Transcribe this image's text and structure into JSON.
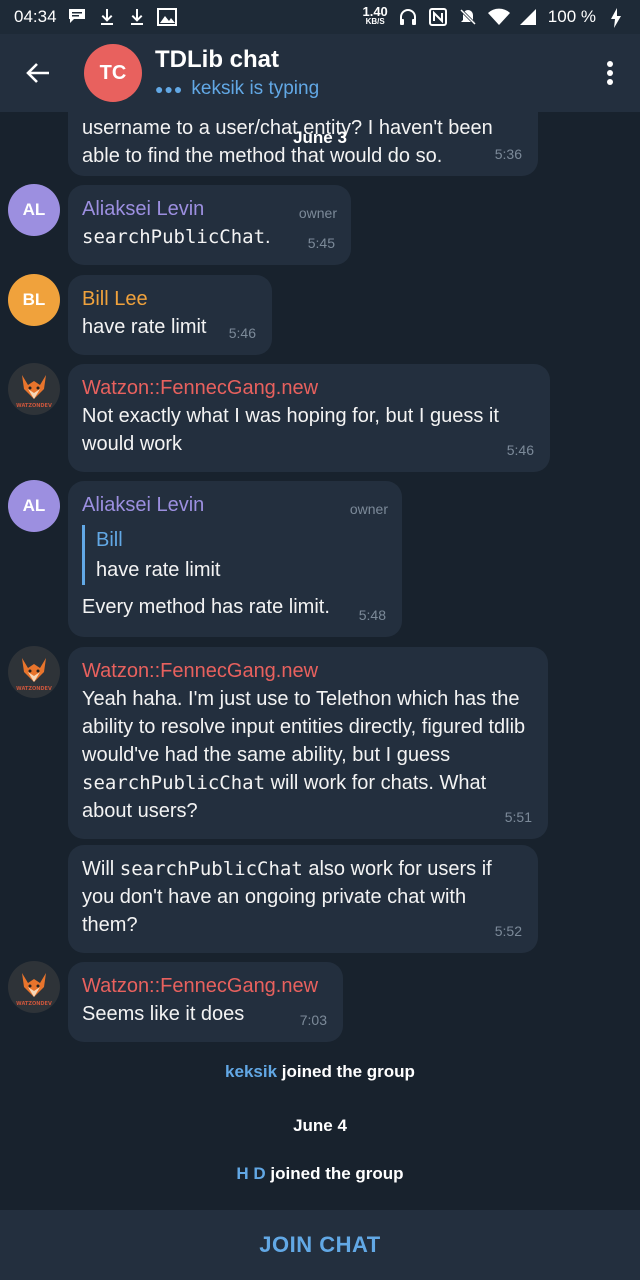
{
  "status_bar": {
    "time": "04:34",
    "net_speed_value": "1.40",
    "net_speed_unit": "KB/S",
    "battery": "100 %",
    "icons": [
      "chat-notification-icon",
      "download-icon",
      "download-icon",
      "gallery-icon",
      "headphones-icon",
      "nfc-icon",
      "mute-bell-icon",
      "wifi-icon",
      "signal-icon",
      "charging-icon"
    ]
  },
  "header": {
    "avatar_initials": "TC",
    "avatar_color": "#e8615e",
    "title": "TDLib chat",
    "status": "keksik is typing"
  },
  "floating_date": "June 3",
  "messages": [
    {
      "text": "username to a user/chat entity? I haven't been able to find the method that would do so.",
      "time": "5:36"
    },
    {
      "author": "Aliaksei Levin",
      "author_color": "#9c8fe0",
      "avatar": "AL",
      "avatar_color": "#9c8fe0",
      "badge": "owner",
      "code": "searchPublicChat",
      "text_after": ".",
      "time": "5:45"
    },
    {
      "author": "Bill Lee",
      "author_color": "#f0a23c",
      "avatar": "BL",
      "avatar_color": "#f0a23c",
      "text": "have rate limit",
      "time": "5:46"
    },
    {
      "author": "Watzon::FennecGang.new",
      "author_color": "#e8615e",
      "text": "Not exactly what I was hoping for, but I guess it would work",
      "time": "5:46"
    },
    {
      "author": "Aliaksei Levin",
      "author_color": "#9c8fe0",
      "avatar": "AL",
      "avatar_color": "#9c8fe0",
      "badge": "owner",
      "reply_name": "Bill",
      "reply_text": "have rate limit",
      "text": "Every method has rate limit.",
      "time": "5:48"
    },
    {
      "author": "Watzon::FennecGang.new",
      "author_color": "#e8615e",
      "text_before": "Yeah haha. I'm just use to Telethon which has the ability to resolve input entities directly, figured tdlib would've had the same ability, but I guess ",
      "code": "searchPublicChat",
      "text_after": " will work for chats. What about users?",
      "time": "5:51"
    },
    {
      "text_before": "Will ",
      "code": "searchPublicChat",
      "text_after": " also work for users if you don't have an ongoing private chat with them?",
      "time": "5:52"
    },
    {
      "author": "Watzon::FennecGang.new",
      "author_color": "#e8615e",
      "text": "Seems like it does",
      "time": "7:03"
    }
  ],
  "fox_avatar_label": "WATZONDEV",
  "service": [
    {
      "who": "keksik",
      "action": " joined the group"
    },
    {
      "date": "June 4"
    },
    {
      "who": "H D",
      "action": " joined the group"
    }
  ],
  "join_button": "JOIN CHAT"
}
